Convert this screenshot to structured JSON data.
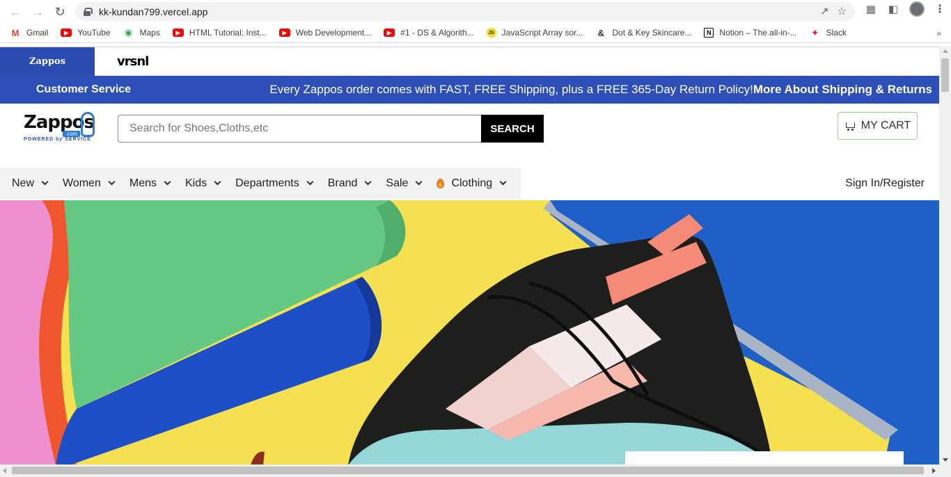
{
  "browser": {
    "url": "kk-kundan799.vercel.app",
    "bookmarks": [
      {
        "label": "Gmail",
        "icon": "gmail-icon"
      },
      {
        "label": "YouTube",
        "icon": "youtube-icon"
      },
      {
        "label": "Maps",
        "icon": "maps-icon"
      },
      {
        "label": "HTML Tutorial: Inst...",
        "icon": "youtube-icon"
      },
      {
        "label": "Web Development...",
        "icon": "youtube-icon"
      },
      {
        "label": "#1 - DS & Algorith...",
        "icon": "youtube-icon"
      },
      {
        "label": "JavaScript Array sor...",
        "icon": "js-icon"
      },
      {
        "label": "Dot & Key Skincare...",
        "icon": "dot-key-icon"
      },
      {
        "label": "Notion – The all-in-...",
        "icon": "notion-icon"
      },
      {
        "label": "Slack",
        "icon": "slack-icon"
      }
    ]
  },
  "brand_strip": {
    "tab_label": "Zappos",
    "tab_sub": "",
    "partner": "vrsnl"
  },
  "promo": {
    "customer_service": "Customer Service",
    "message": "Every Zappos order comes with FAST, FREE Shipping, plus a FREE 365-Day Return Policy!",
    "link": "More About Shipping & Returns"
  },
  "header": {
    "logo_text": "Zappos",
    "logo_com": ".com",
    "logo_tag": "POWERED by SERVICE",
    "search_placeholder": "Search for Shoes,Cloths,etc",
    "search_button": "SEARCH",
    "cart_label": "MY CART"
  },
  "nav": {
    "items": [
      "New",
      "Women",
      "Mens",
      "Kids",
      "Departments",
      "Brand",
      "Sale",
      "Clothing"
    ],
    "sign_in": "Sign In/Register"
  },
  "colors": {
    "brand_blue": "#2e4fb8",
    "hero_yellow": "#f4e051",
    "cart_border": "#9bd18a"
  }
}
